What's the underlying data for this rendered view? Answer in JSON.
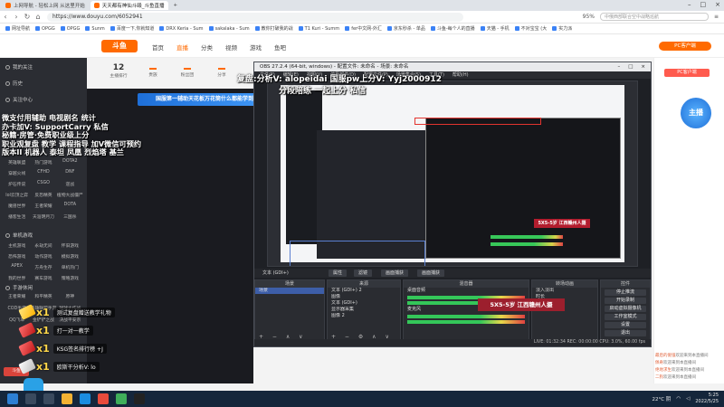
{
  "browser": {
    "tabs": [
      {
        "label": "上网导航 - 轻松上网 从这里开始"
      },
      {
        "label": "天天都有神仙斗殴_斗鱼直播"
      },
      {
        "label": ""
      },
      {
        "label": ""
      }
    ],
    "url": "https://www.douyu.com/6052941",
    "zoom": "95%",
    "search_placeholder": "中俄西部联合空中战略巡航",
    "bookmarks": [
      "网址导航",
      "OPGG",
      "OPGG",
      "Sunm",
      "百度一下,你就知道",
      "DRX Keria - Sum",
      "sakalaka - Sum",
      "教你打破我的战",
      "T1 Kuri - Summ",
      "fer中文网-外汇",
      "京东秒杀 - 单品",
      "斗鱼-每个人的直播",
      "天猫 - 手机",
      "不对宝宝 (大",
      "实力派"
    ]
  },
  "douyu": {
    "nav": [
      "首页",
      "直播",
      "分类",
      "视频",
      "游戏",
      "鱼吧"
    ],
    "active_nav": "直播",
    "pc_badge": "PC客户端",
    "rank": [
      {
        "big": "12",
        "label": "主播排行"
      },
      {
        "big": "",
        "label": "贵族"
      },
      {
        "big": "",
        "label": "粉丝团"
      },
      {
        "big": "",
        "label": "分享"
      }
    ],
    "promo": "国服第一辅助天花板万花筒什么都能学到",
    "right_banner": "主播"
  },
  "sidebar": {
    "top_items": [
      "我的关注",
      "历史",
      "关注中心"
    ],
    "grid1": [
      "英雄联盟",
      "热门游戏",
      "DOTA2",
      "穿越火线",
      "CFHD",
      "DNF",
      "炉石传说",
      "CSGO",
      "逆战",
      "lol云顶之弈",
      "反恐精英",
      "植物大战僵尸",
      "魔兽世界",
      "王者荣耀",
      "DOTA",
      "播客生活",
      "天涯明月刀",
      "三国杀"
    ],
    "section2": "单机游戏",
    "grid2": [
      "主机游戏",
      "永劫无间",
      "怀旧游戏",
      "恐怖游戏",
      "动作游戏",
      "模拟游戏",
      "APEX",
      "方舟生存",
      "单机热门",
      "我的世界",
      "赛车游戏",
      "策略游戏"
    ],
    "section3": "手游休闲",
    "grid3": [
      "王者荣耀",
      "和平精英",
      "原神",
      "COD手游",
      "英雄联盟手游",
      "球球大作战",
      "QQ飞车",
      "金铲铲之战",
      "决战平安京"
    ],
    "bottom": "斗鱼"
  },
  "overlay": {
    "title1": "复盘:分析V: alopeidai 国服pw上分V: Yyj2000912",
    "title2": "分段陪练 一起上分 私信",
    "left_lines": [
      "微支付用辅助  电视剧名  统计",
      "办卡加V: SupportCarry 私信",
      "秘籍·房管·免费职业级上分",
      "职业观复盘 教学 课程指导 加V微信可预约",
      "版本II  机器人 泰坦  凤凰  烈焰塔 基兰"
    ],
    "stream_banner": "5X5-5岁 江西赣州人摄"
  },
  "gifts": [
    {
      "count": "x1",
      "text": "测试复盘赠送教学礼物"
    },
    {
      "count": "x1",
      "text": "打一对一教学"
    },
    {
      "count": "x1",
      "text": "KSG签名排行榜 +J"
    },
    {
      "count": "x1",
      "text": "欧斯干分析V: lo"
    }
  ],
  "obs": {
    "title": "OBS 27.2.4 (64-bit, windows) - 配置文件: 未命名 - 场景: 未命名",
    "menu": [
      "文件(F)",
      "编辑(E)",
      "视图(V)",
      "停靠部件(D)",
      "配置文件(P)",
      "场景集合(S)",
      "工具(T)",
      "帮助(H)"
    ],
    "toolbar": [
      "属性",
      "滤镜",
      "画面捕获",
      "画面捕获"
    ],
    "toolbar_source": "文本 (GDI+)",
    "docks": {
      "scenes": {
        "title": "场景",
        "items": [
          "场景"
        ]
      },
      "sources": {
        "title": "来源",
        "items": [
          "文本 (GDI+) 2",
          "图像",
          "文本 (GDI+)",
          "显示器采集",
          "图像 2"
        ]
      },
      "mixer": {
        "title": "混音器",
        "items": [
          "桌面音频",
          "麦克风"
        ]
      },
      "transitions": {
        "title": "转场动画",
        "items": [
          "淡入淡出",
          "时长"
        ]
      },
      "controls": {
        "title": "控件",
        "items": [
          "停止推流",
          "开始录制",
          "启动虚拟摄像机",
          "工作室模式",
          "设置",
          "退出"
        ]
      }
    },
    "status": "LIVE: 01:32:34  REC: 00:00:00  CPU: 3.0%, 60.00 fps"
  },
  "chat": [
    {
      "user": "最后的倔强",
      "text": "欢迎来到本直播间"
    },
    {
      "user": "佩奇",
      "text": "欢迎来到本直播间"
    },
    {
      "user": "绝地求生",
      "text": "欢迎来到本直播间"
    },
    {
      "user": "二狗",
      "text": "欢迎来到本直播间"
    }
  ],
  "taskbar": {
    "weather": "22°C 阴",
    "time": "5:25",
    "date": "2022/5/25"
  },
  "colors": {
    "accent": "#ff6a00",
    "obs_bg": "#1e2025",
    "taskbar": "#15263b"
  }
}
